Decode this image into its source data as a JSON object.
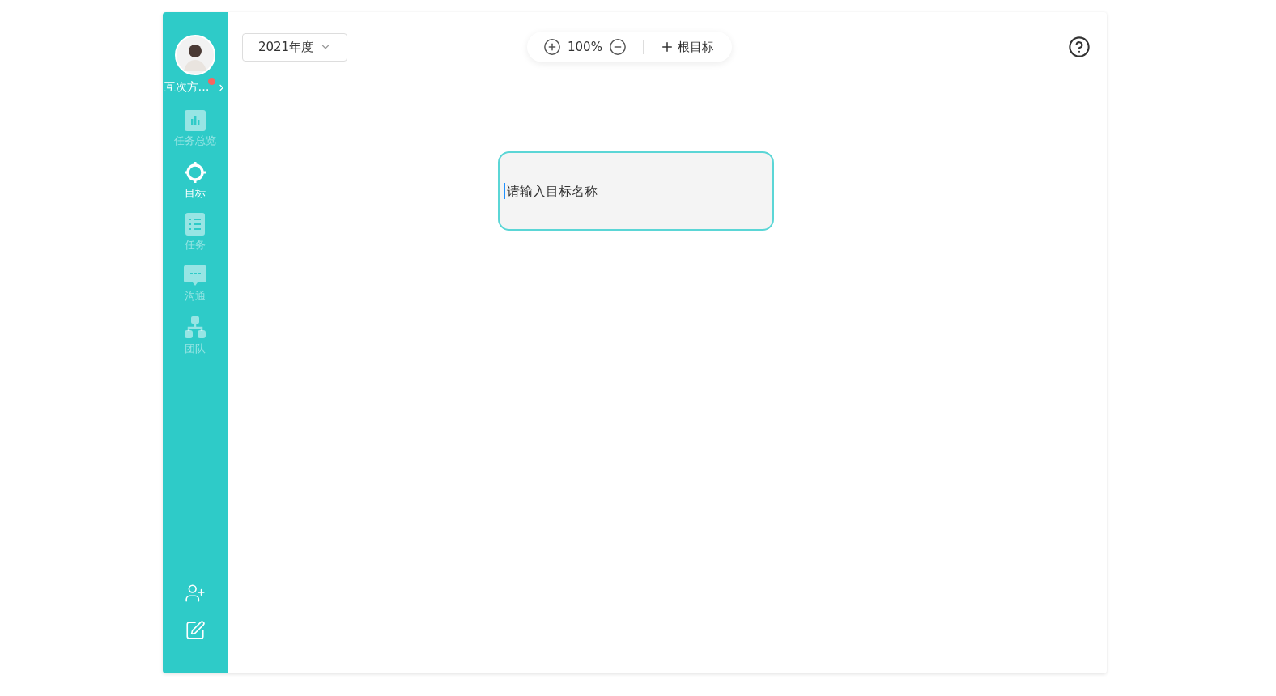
{
  "sidebar": {
    "user": {
      "name": "互次方…",
      "unread": true
    },
    "items": [
      {
        "kind": "chart",
        "label": "任务总览",
        "selected": false
      },
      {
        "kind": "target",
        "label": "目标",
        "selected": true
      },
      {
        "kind": "list",
        "label": "任务",
        "selected": false
      },
      {
        "kind": "chat",
        "label": "沟通",
        "selected": false
      },
      {
        "kind": "team",
        "label": "团队",
        "selected": false
      }
    ]
  },
  "toolbar": {
    "year_select": "2021年度",
    "zoom": "100%",
    "add_root": "根目标"
  },
  "canvas": {
    "node": {
      "placeholder": "请输入目标名称",
      "focused": true
    }
  }
}
